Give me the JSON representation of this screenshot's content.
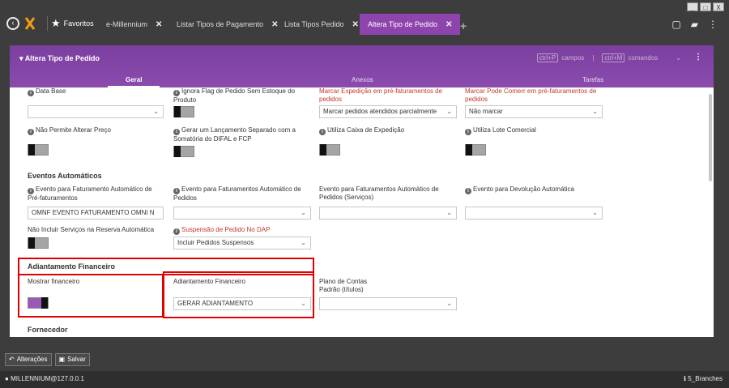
{
  "window": {
    "controls": [
      "_",
      "□",
      "X"
    ]
  },
  "topbar": {
    "favorites_label": "Favoritos",
    "tabs": [
      {
        "label": "e-Millennium"
      },
      {
        "label": "Listar Tipos de Pagamento"
      },
      {
        "label": "Lista Tipos Pedido"
      },
      {
        "label": "Altera Tipo de Pedido"
      }
    ],
    "close_glyph": "✕",
    "add_tab_glyph": "+"
  },
  "panel": {
    "title": "Altera Tipo de Pedido",
    "shortcut1_key": "ctrl+P",
    "shortcut1_label": "campos",
    "sep": "|",
    "shortcut2_key": "ctrl+M",
    "shortcut2_label": "comandos",
    "tabs": [
      "Geral",
      "Anexos",
      "Tarefas"
    ]
  },
  "form": {
    "data_base_label": "Data Base",
    "ignora_flag_label": "Ignora Flag de Pedido Sem Estoque do Produto",
    "marcar_expedicao_label": "Marcar Expedição em pré-faturamentos de pedidos",
    "marcar_expedicao_value": "Marcar pedidos atendidos parcialmente",
    "marcar_pode_comerr_label": "Marcar Pode Comerr em pré-faturamentos de pedidos",
    "marcar_pode_comerr_value": "Não marcar",
    "nao_permite_label": "Não Permite Alterar Preço",
    "gerar_lancamento_label": "Gerar um Lançamento Separado com a Somatória do DIFAL e FCP",
    "utiliza_caixa_label": "Utiliza Caixa de Expedição",
    "utiliza_lote_label": "Utiliza Lote Comercial",
    "eventos_section": "Eventos Automáticos",
    "evento_fat_pre_label": "Evento para Faturamento Automático de Pré-faturamentos",
    "evento_fat_pre_value": "OMNF EVENTO FATURAMENTO OMNI N",
    "evento_fat_ped_label": "Evento para Faturamentos Automático de Pedidos",
    "evento_fat_serv_label": "Evento para Faturamentos Automático de Pedidos (Serviços)",
    "evento_dev_label": "Evento para Devolução Automática",
    "nao_incluir_label": "Não Incluir Serviços na Reserva Automática",
    "suspensao_label": "Suspensão de Pedido No DAP",
    "suspensao_value": "Incluir Pedidos Suspensos",
    "adiantamento_section": "Adiantamento Financeiro",
    "mostrar_fin_label": "Mostrar financeiro",
    "adiantamento_label": "Adiantamento Financeiro",
    "adiantamento_value": "GERAR ADIANTAMENTO",
    "plano_contas_label": "Plano de Contas Padrão (títulos)",
    "fornecedor_section": "Fornecedor"
  },
  "bottom": {
    "alteracoes_label": "Alterações",
    "salvar_label": "Salvar",
    "user_label": "MILLENNIUM@127.0.0.1",
    "branch_label": "5_Branches"
  },
  "colors": {
    "accent": "#8e44ad",
    "highlight": "#e00000"
  }
}
